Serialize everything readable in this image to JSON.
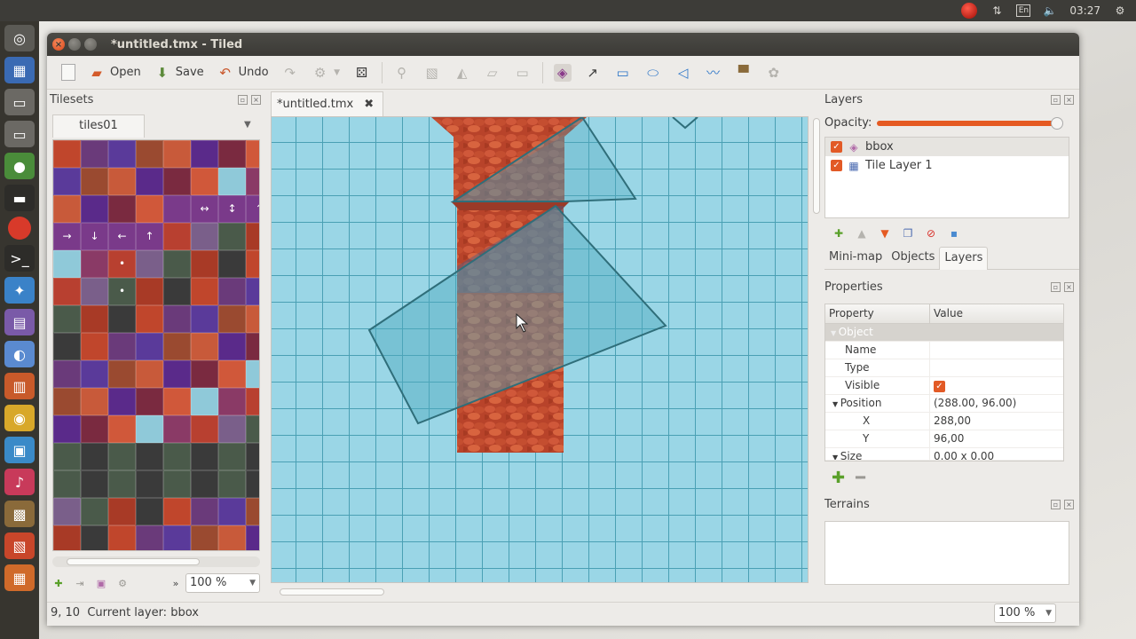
{
  "system": {
    "clock": "03:27",
    "keyboard": "En"
  },
  "window": {
    "title": "*untitled.tmx - Tiled"
  },
  "toolbar": {
    "open_label": "Open",
    "save_label": "Save",
    "undo_label": "Undo"
  },
  "tilesets": {
    "title": "Tilesets",
    "active_tab": "tiles01",
    "zoom": "100 %"
  },
  "document": {
    "tab_label": "*untitled.tmx"
  },
  "layers": {
    "title": "Layers",
    "opacity_label": "Opacity:",
    "opacity_value": 1.0,
    "items": [
      {
        "name": "bbox",
        "visible": true,
        "type": "object",
        "selected": true
      },
      {
        "name": "Tile Layer 1",
        "visible": true,
        "type": "tile",
        "selected": false
      }
    ]
  },
  "right_tabs": {
    "minimap": "Mini-map",
    "objects": "Objects",
    "layers": "Layers"
  },
  "properties": {
    "title": "Properties",
    "col_property": "Property",
    "col_value": "Value",
    "group_object": "Object",
    "name_label": "Name",
    "name_value": "",
    "type_label": "Type",
    "type_value": "",
    "visible_label": "Visible",
    "position_label": "Position",
    "position_value": "(288.00, 96.00)",
    "x_label": "X",
    "x_value": "288,00",
    "y_label": "Y",
    "y_value": "96,00",
    "size_label": "Size",
    "size_value": "0.00 x 0.00"
  },
  "terrains": {
    "title": "Terrains"
  },
  "statusbar": {
    "text": "9, 10  Current layer: bbox",
    "zoom": "100 %"
  },
  "colors": {
    "accent": "#e55a22",
    "map_bg": "#9ad6e6",
    "grid": "#4aa0b4",
    "titlebar": "#3b3a36"
  }
}
